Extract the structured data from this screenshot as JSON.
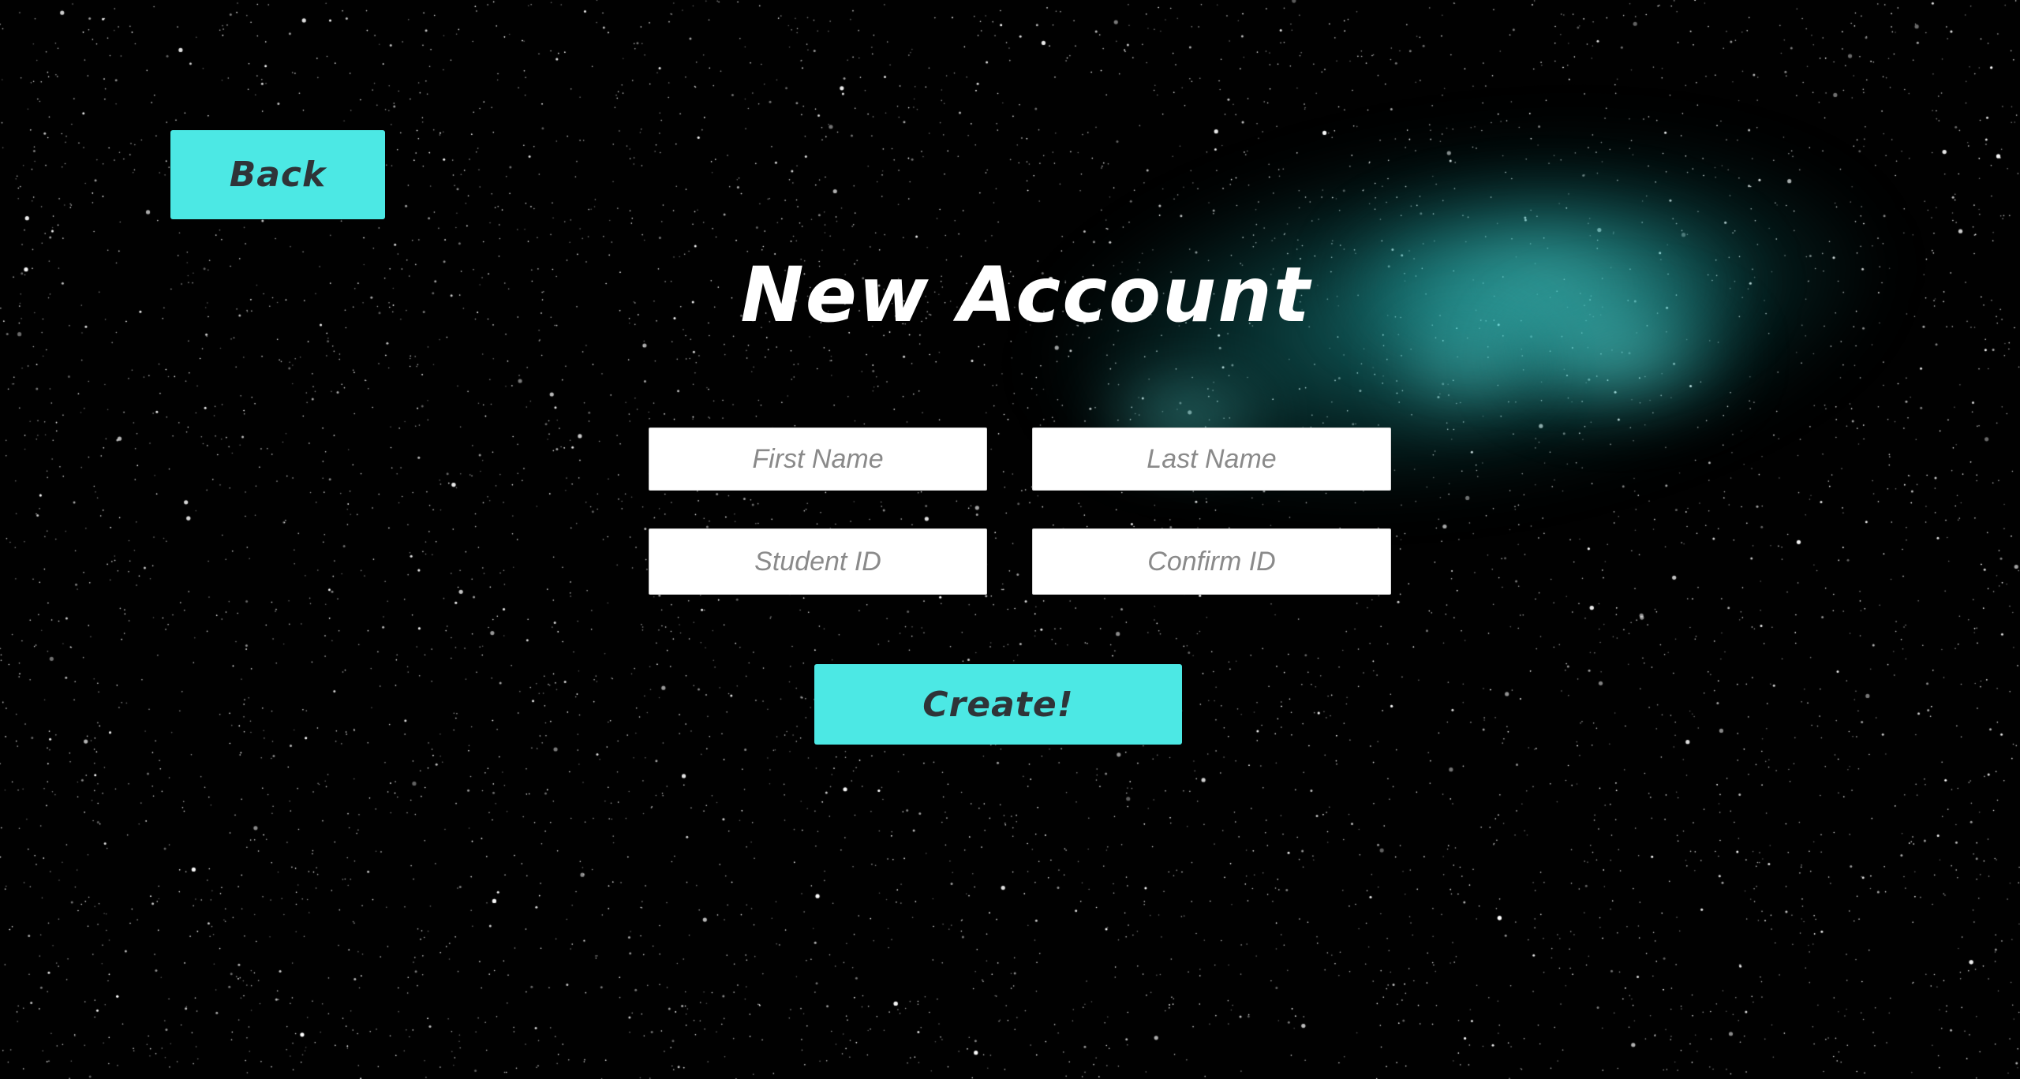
{
  "screen": {
    "title": "New Account",
    "background": "starfield with teal nebula",
    "accent_color": "#4ce8e4",
    "button_text_color": "#2f3438"
  },
  "buttons": {
    "back_label": "Back",
    "create_label": "Create!"
  },
  "form": {
    "first_name_placeholder": "First Name",
    "last_name_placeholder": "Last Name",
    "student_id_placeholder": "Student ID",
    "confirm_id_placeholder": "Confirm ID",
    "first_name_value": "",
    "last_name_value": "",
    "student_id_value": "",
    "confirm_id_value": ""
  }
}
